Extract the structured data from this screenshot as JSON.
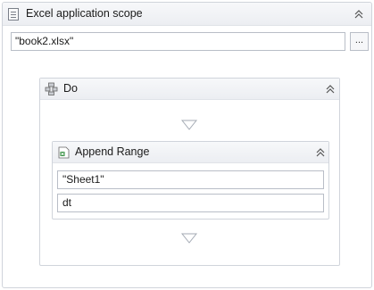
{
  "scope": {
    "title": "Excel application scope",
    "icon": "excel-scope-icon",
    "workbook_path": "\"book2.xlsx\"",
    "browse_label": "..."
  },
  "do_block": {
    "title": "Do",
    "icon": "sequence-icon"
  },
  "append_range": {
    "title": "Append Range",
    "icon": "excel-sheet-icon",
    "sheet_name": "\"Sheet1\"",
    "data_table": "dt"
  }
}
